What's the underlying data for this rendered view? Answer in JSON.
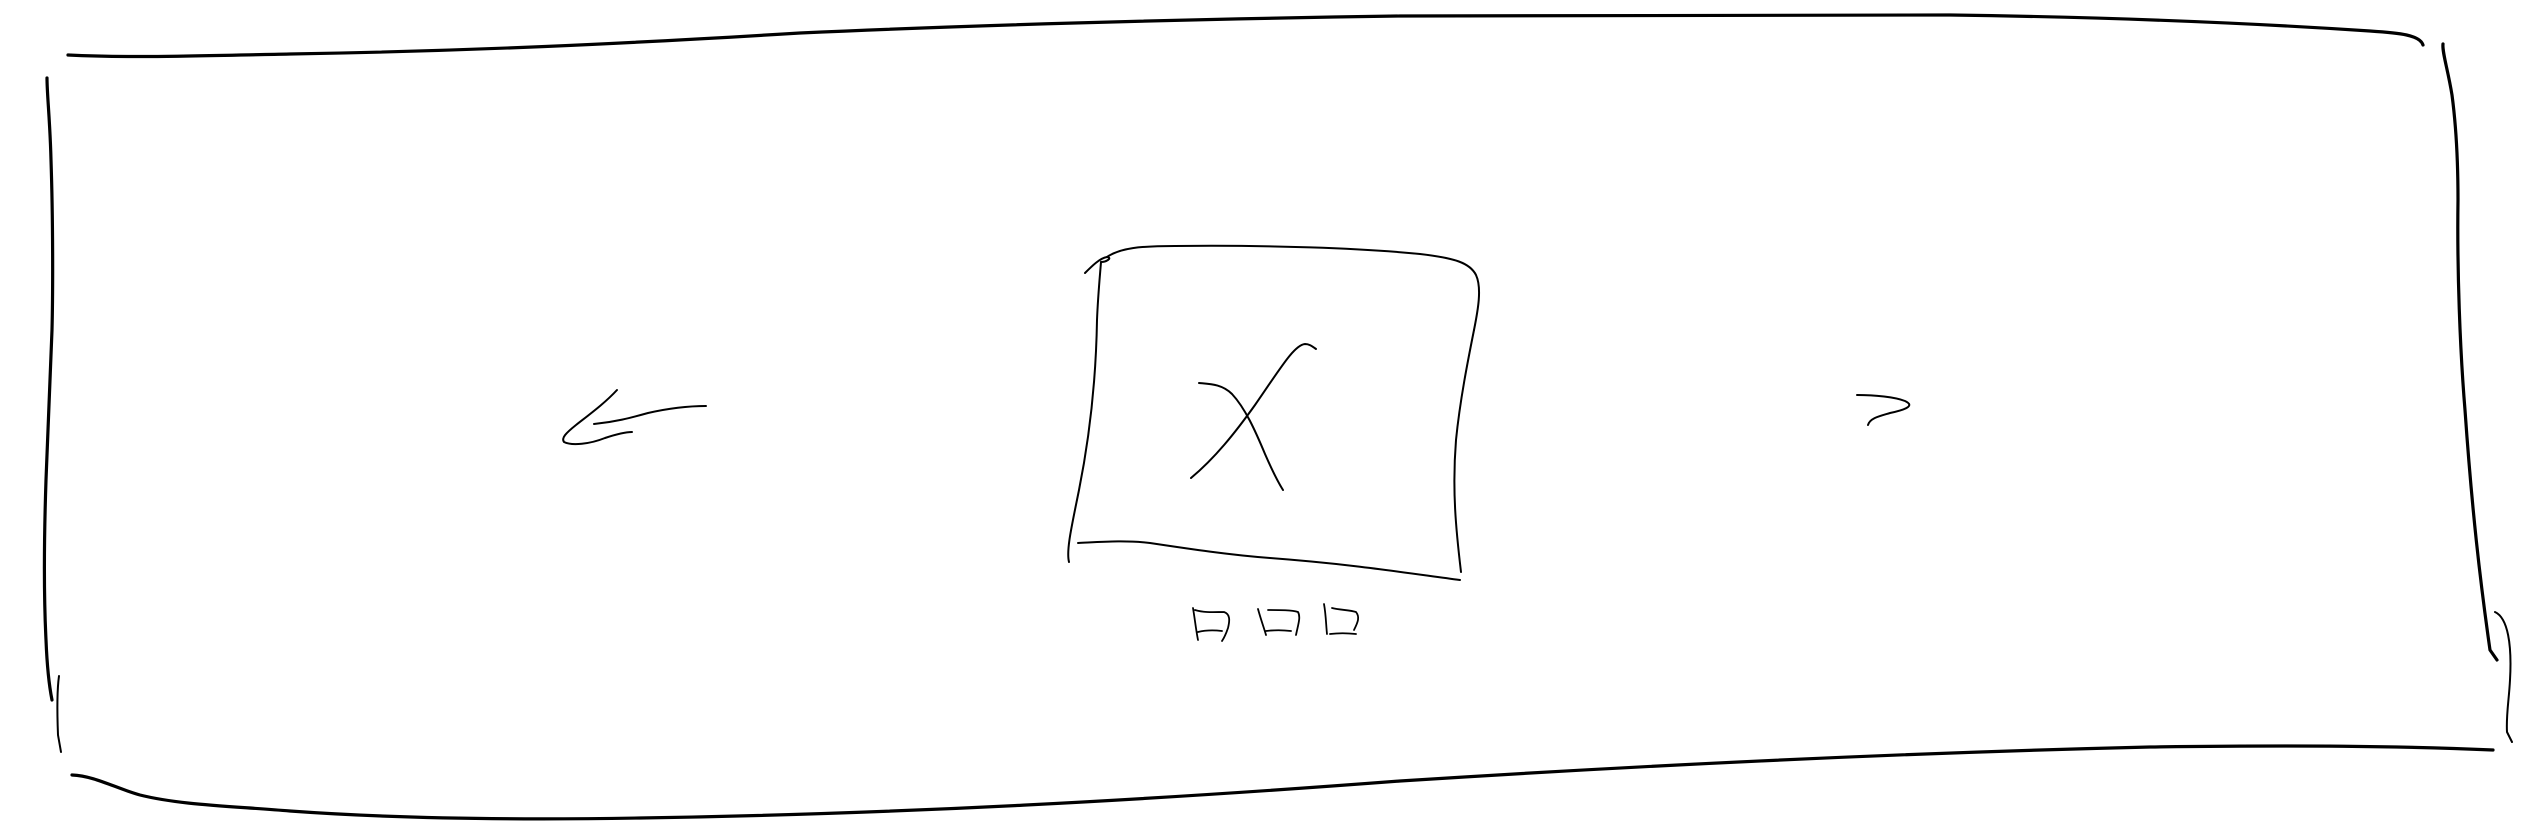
{
  "carousel": {
    "prev_arrow_icon": "arrow-left-icon",
    "next_arrow_icon": "chevron-right-icon",
    "image_placeholder_icon": "x-cross-icon",
    "slide_count": 3,
    "stroke_color": "#000000",
    "background_color": "#ffffff"
  }
}
